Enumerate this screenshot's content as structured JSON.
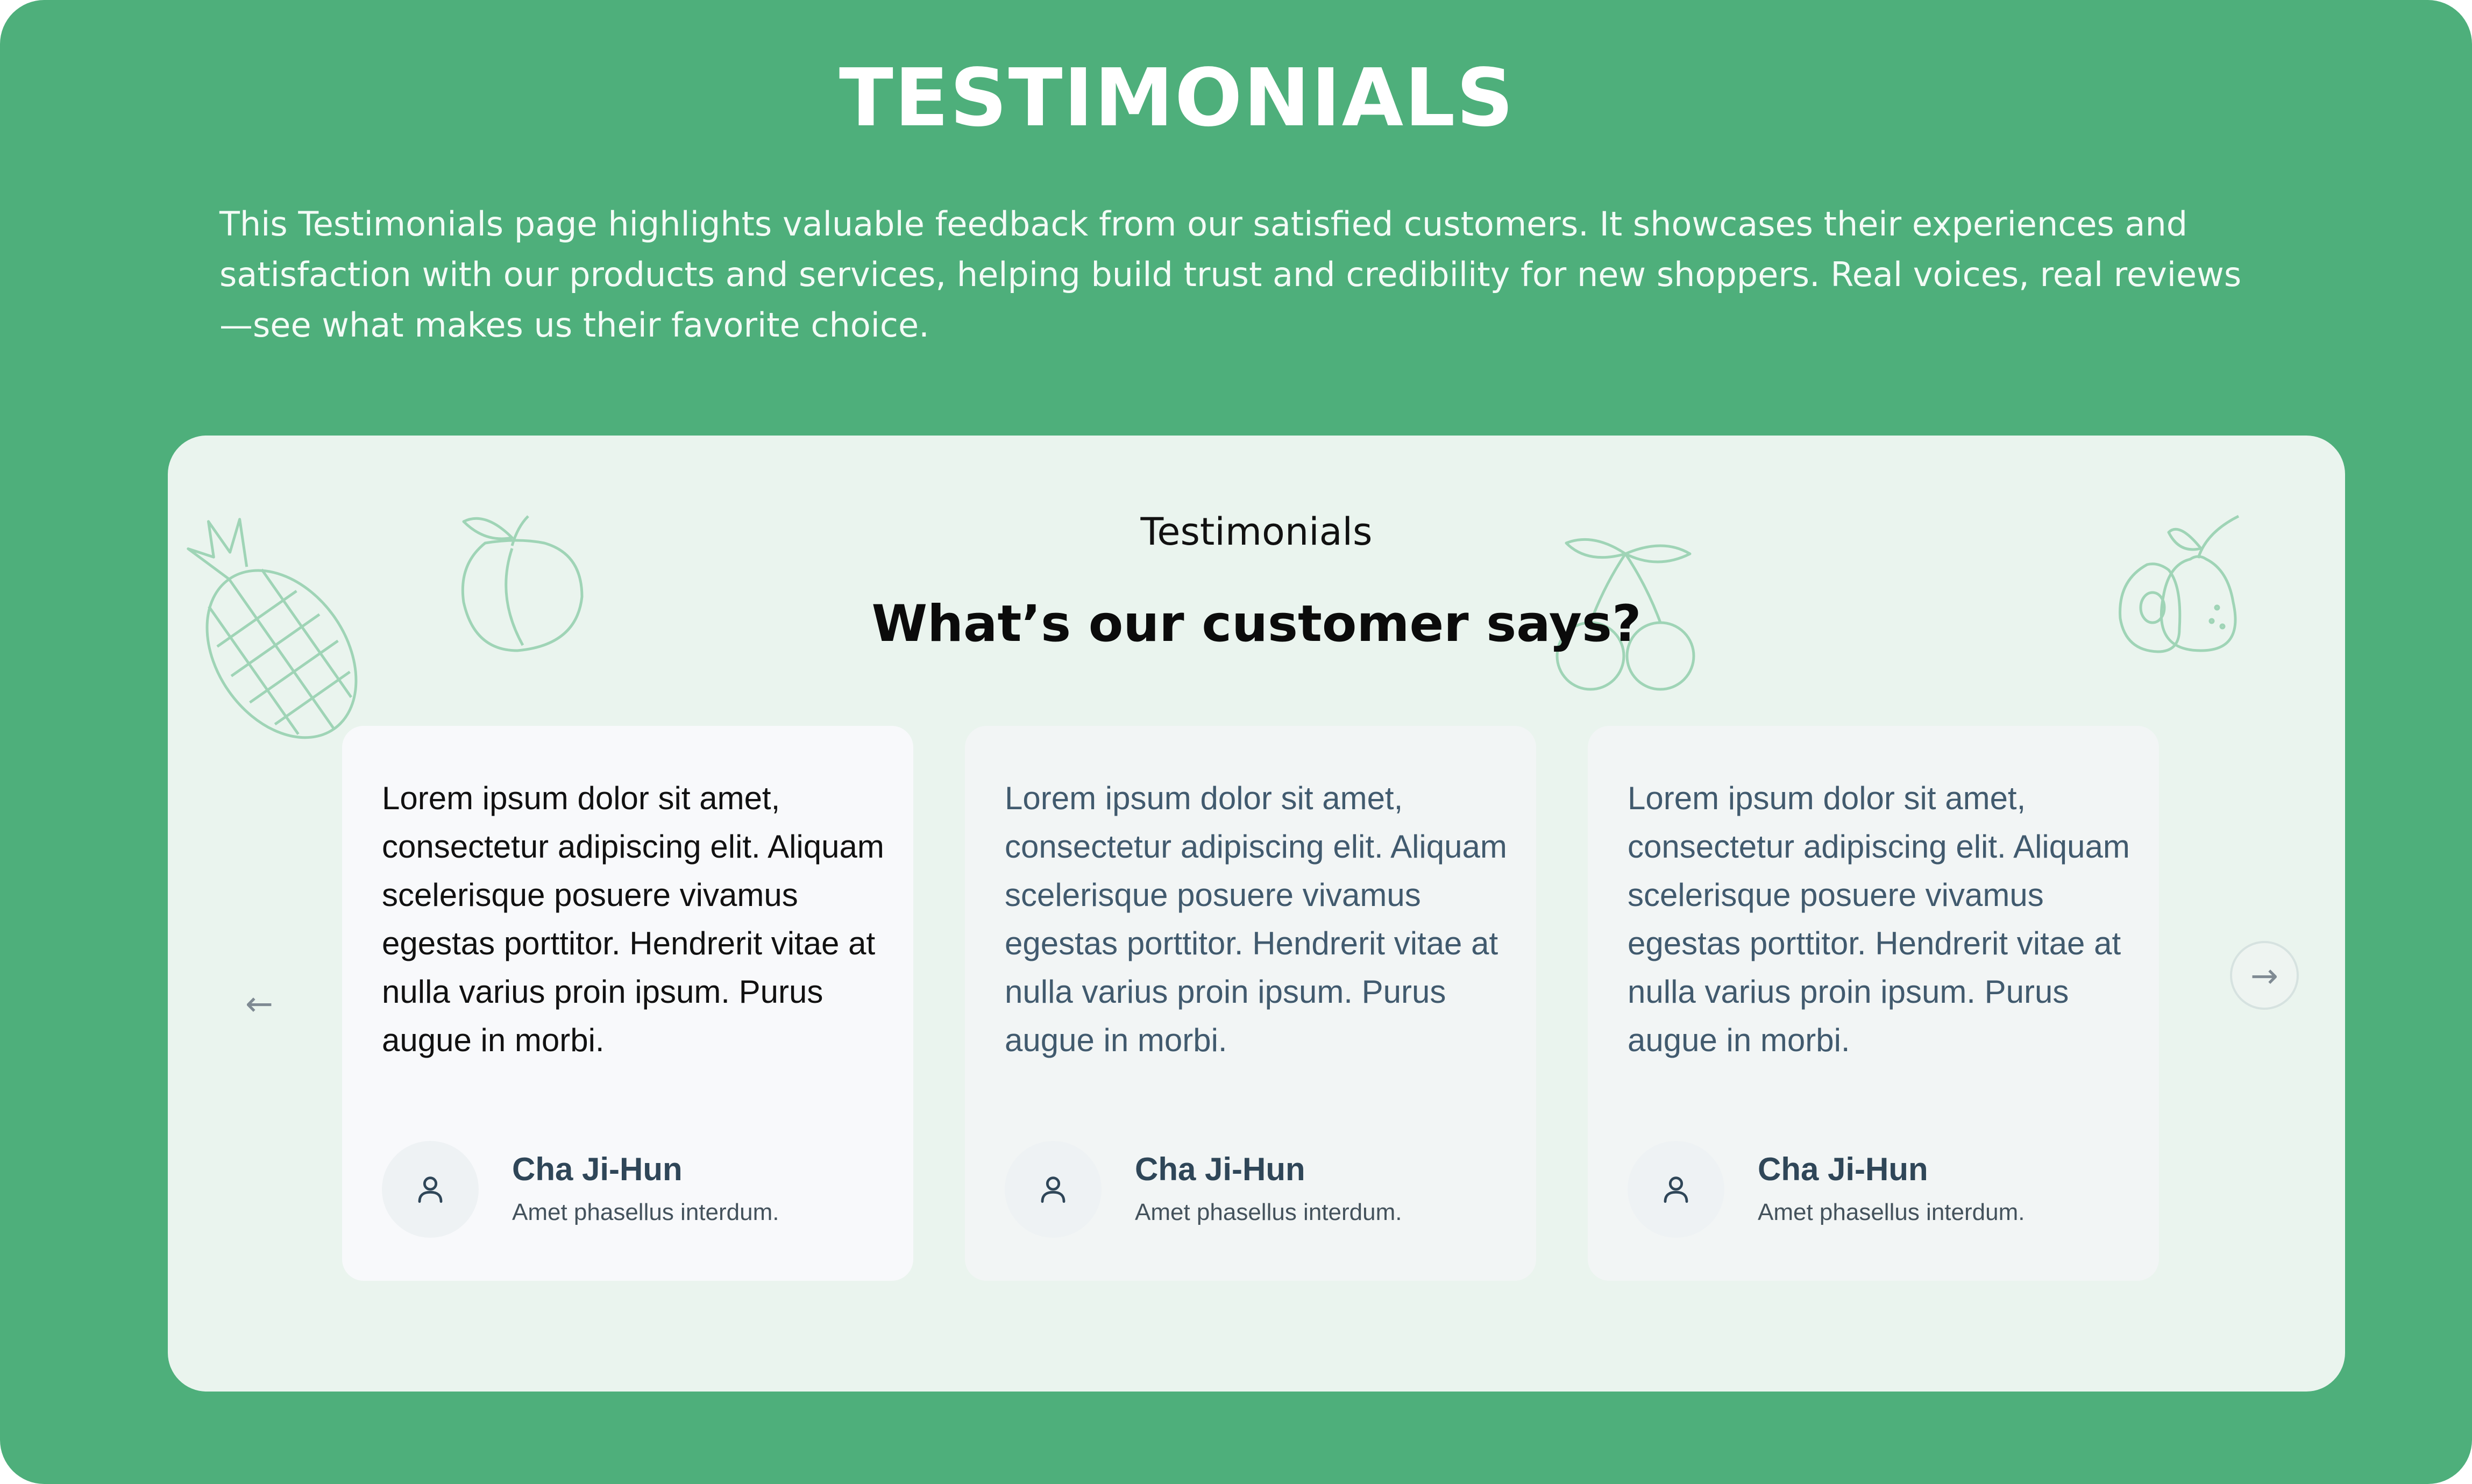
{
  "header": {
    "title": "TESTIMONIALS",
    "intro": "This Testimonials page highlights valuable feedback from our satisfied customers. It showcases their experiences and satisfaction with our products and services, helping build trust and credibility for new shoppers. Real voices, real reviews—see what makes us their favorite choice."
  },
  "section": {
    "eyebrow": "Testimonials",
    "heading": "What’s our customer says?"
  },
  "carousel": {
    "prev_icon": "arrow-left-icon",
    "next_icon": "arrow-right-icon",
    "cards": [
      {
        "quote": "Lorem ipsum dolor sit amet, consectetur adipiscing elit. Aliquam scelerisque posuere vivamus egestas porttitor. Hendrerit vitae at nulla varius proin ipsum. Purus augue in morbi.",
        "name": "Cha Ji-Hun",
        "role": "Amet phasellus interdum.",
        "avatar_icon": "user-icon"
      },
      {
        "quote": "Lorem ipsum dolor sit amet, consectetur adipiscing elit. Aliquam scelerisque posuere vivamus egestas porttitor. Hendrerit vitae at nulla varius proin ipsum. Purus augue in morbi.",
        "name": "Cha Ji-Hun",
        "role": "Amet phasellus interdum.",
        "avatar_icon": "user-icon"
      },
      {
        "quote": "Lorem ipsum dolor sit amet, consectetur adipiscing elit. Aliquam scelerisque posuere vivamus egestas porttitor. Hendrerit vitae at nulla varius proin ipsum. Purus augue in morbi.",
        "name": "Cha Ji-Hun",
        "role": "Amet phasellus interdum.",
        "avatar_icon": "user-icon"
      }
    ]
  },
  "decorations": [
    "pineapple-icon",
    "peach-icon",
    "cherries-icon",
    "pear-icon"
  ],
  "colors": {
    "brand_green": "#4eaf7b",
    "panel_bg": "#eaf4ee",
    "card_bg": "#f2f5f5",
    "card_active_bg": "#f8f9fb",
    "text_muted": "#415a6e",
    "fruit_line": "#9fd4b6"
  }
}
